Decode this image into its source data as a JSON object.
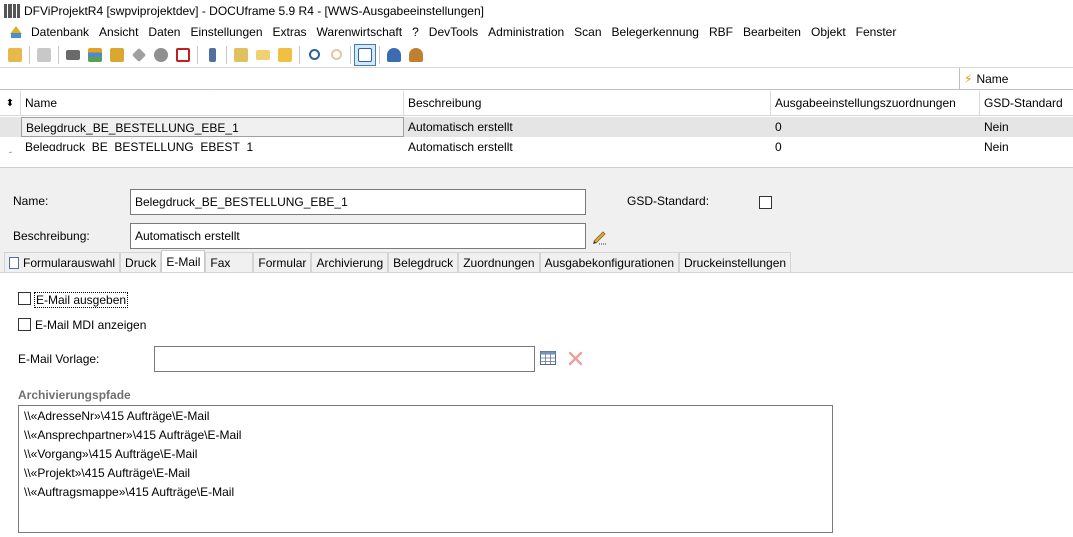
{
  "window": {
    "title": "DFViProjektR4 [swpviprojektdev] - DOCUframe 5.9 R4 - [WWS-Ausgabeeinstellungen]"
  },
  "menu": {
    "items": [
      "Datenbank",
      "Ansicht",
      "Daten",
      "Einstellungen",
      "Extras",
      "Warenwirtschaft",
      "?",
      "DevTools",
      "Administration",
      "Scan",
      "Belegerkennung",
      "RBF",
      "Bearbeiten",
      "Objekt",
      "Fenster"
    ]
  },
  "column_chooser": {
    "label": "Name"
  },
  "grid": {
    "columns": [
      "Name",
      "Beschreibung",
      "Ausgabeeinstellungszuordnungen",
      "GSD-Standard"
    ],
    "rows": [
      [
        "Belegdruck_BE_BESTELLUNG_EBE_1",
        "Automatisch erstellt",
        "0",
        "Nein"
      ],
      [
        "Belegdruck_BE_BESTELLUNG_EBEST_1",
        "Automatisch erstellt",
        "0",
        "Nein"
      ]
    ]
  },
  "form": {
    "name_label": "Name:",
    "name_value": "Belegdruck_BE_BESTELLUNG_EBE_1",
    "gsd_label": "GSD-Standard:",
    "beschreibung_label": "Beschreibung:",
    "beschreibung_value": "Automatisch erstellt"
  },
  "tabs": [
    "Formularauswahl",
    "Druck",
    "E-Mail",
    "Fax",
    "Formular",
    "Archivierung",
    "Belegdruck",
    "Zuordnungen",
    "Ausgabekonfigurationen",
    "Druckeinstellungen"
  ],
  "active_tab": "E-Mail",
  "email": {
    "email_ausgeben_label": "E-Mail ausgeben",
    "email_mdi_label": "E-Mail MDI anzeigen",
    "vorlage_label": "E-Mail Vorlage:",
    "vorlage_value": "",
    "archiv_title": "Archivierungspfade",
    "archiv_paths": [
      "\\\\«AdresseNr»\\415 Aufträge\\E-Mail",
      "\\\\«Ansprechpartner»\\415 Aufträge\\E-Mail",
      "\\\\«Vorgang»\\415 Aufträge\\E-Mail",
      "\\\\«Projekt»\\415 Aufträge\\E-Mail",
      "\\\\«Auftragsmappe»\\415 Aufträge\\E-Mail"
    ]
  },
  "colors": {
    "selected_row": "#e5e5e5",
    "panel_bg": "#f0f0f0",
    "delete_icon": "#e8a0a0"
  }
}
